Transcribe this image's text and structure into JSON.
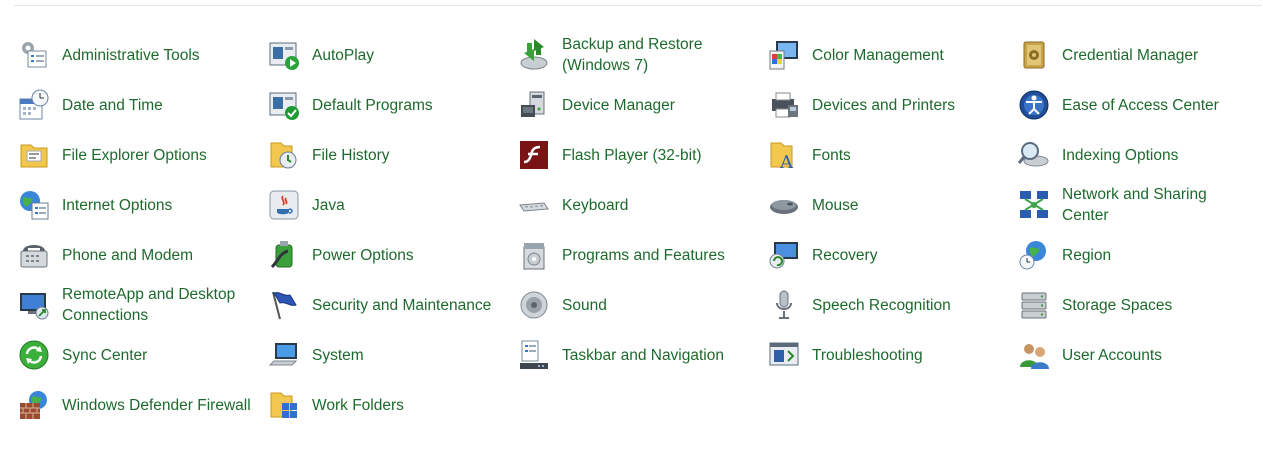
{
  "colors": {
    "link_text": "#1e6a2e",
    "divider": "#e6e6e6",
    "background": "#ffffff"
  },
  "items": [
    {
      "label": "Administrative Tools",
      "icon": "administrative-tools-icon"
    },
    {
      "label": "AutoPlay",
      "icon": "autoplay-icon"
    },
    {
      "label": "Backup and Restore (Windows 7)",
      "icon": "backup-restore-icon"
    },
    {
      "label": "Color Management",
      "icon": "color-management-icon"
    },
    {
      "label": "Credential Manager",
      "icon": "credential-manager-icon"
    },
    {
      "label": "Date and Time",
      "icon": "date-time-icon"
    },
    {
      "label": "Default Programs",
      "icon": "default-programs-icon"
    },
    {
      "label": "Device Manager",
      "icon": "device-manager-icon"
    },
    {
      "label": "Devices and Printers",
      "icon": "devices-printers-icon"
    },
    {
      "label": "Ease of Access Center",
      "icon": "ease-of-access-icon"
    },
    {
      "label": "File Explorer Options",
      "icon": "file-explorer-options-icon"
    },
    {
      "label": "File History",
      "icon": "file-history-icon"
    },
    {
      "label": "Flash Player (32-bit)",
      "icon": "flash-player-icon"
    },
    {
      "label": "Fonts",
      "icon": "fonts-icon"
    },
    {
      "label": "Indexing Options",
      "icon": "indexing-options-icon"
    },
    {
      "label": "Internet Options",
      "icon": "internet-options-icon"
    },
    {
      "label": "Java",
      "icon": "java-icon"
    },
    {
      "label": "Keyboard",
      "icon": "keyboard-icon"
    },
    {
      "label": "Mouse",
      "icon": "mouse-icon"
    },
    {
      "label": "Network and Sharing Center",
      "icon": "network-sharing-icon"
    },
    {
      "label": "Phone and Modem",
      "icon": "phone-modem-icon"
    },
    {
      "label": "Power Options",
      "icon": "power-options-icon"
    },
    {
      "label": "Programs and Features",
      "icon": "programs-features-icon"
    },
    {
      "label": "Recovery",
      "icon": "recovery-icon"
    },
    {
      "label": "Region",
      "icon": "region-icon"
    },
    {
      "label": "RemoteApp and Desktop Connections",
      "icon": "remoteapp-icon"
    },
    {
      "label": "Security and Maintenance",
      "icon": "security-maintenance-icon"
    },
    {
      "label": "Sound",
      "icon": "sound-icon"
    },
    {
      "label": "Speech Recognition",
      "icon": "speech-recognition-icon"
    },
    {
      "label": "Storage Spaces",
      "icon": "storage-spaces-icon"
    },
    {
      "label": "Sync Center",
      "icon": "sync-center-icon"
    },
    {
      "label": "System",
      "icon": "system-icon"
    },
    {
      "label": "Taskbar and Navigation",
      "icon": "taskbar-navigation-icon"
    },
    {
      "label": "Troubleshooting",
      "icon": "troubleshooting-icon"
    },
    {
      "label": "User Accounts",
      "icon": "user-accounts-icon"
    },
    {
      "label": "Windows Defender Firewall",
      "icon": "windows-firewall-icon"
    },
    {
      "label": "Work Folders",
      "icon": "work-folders-icon"
    }
  ]
}
